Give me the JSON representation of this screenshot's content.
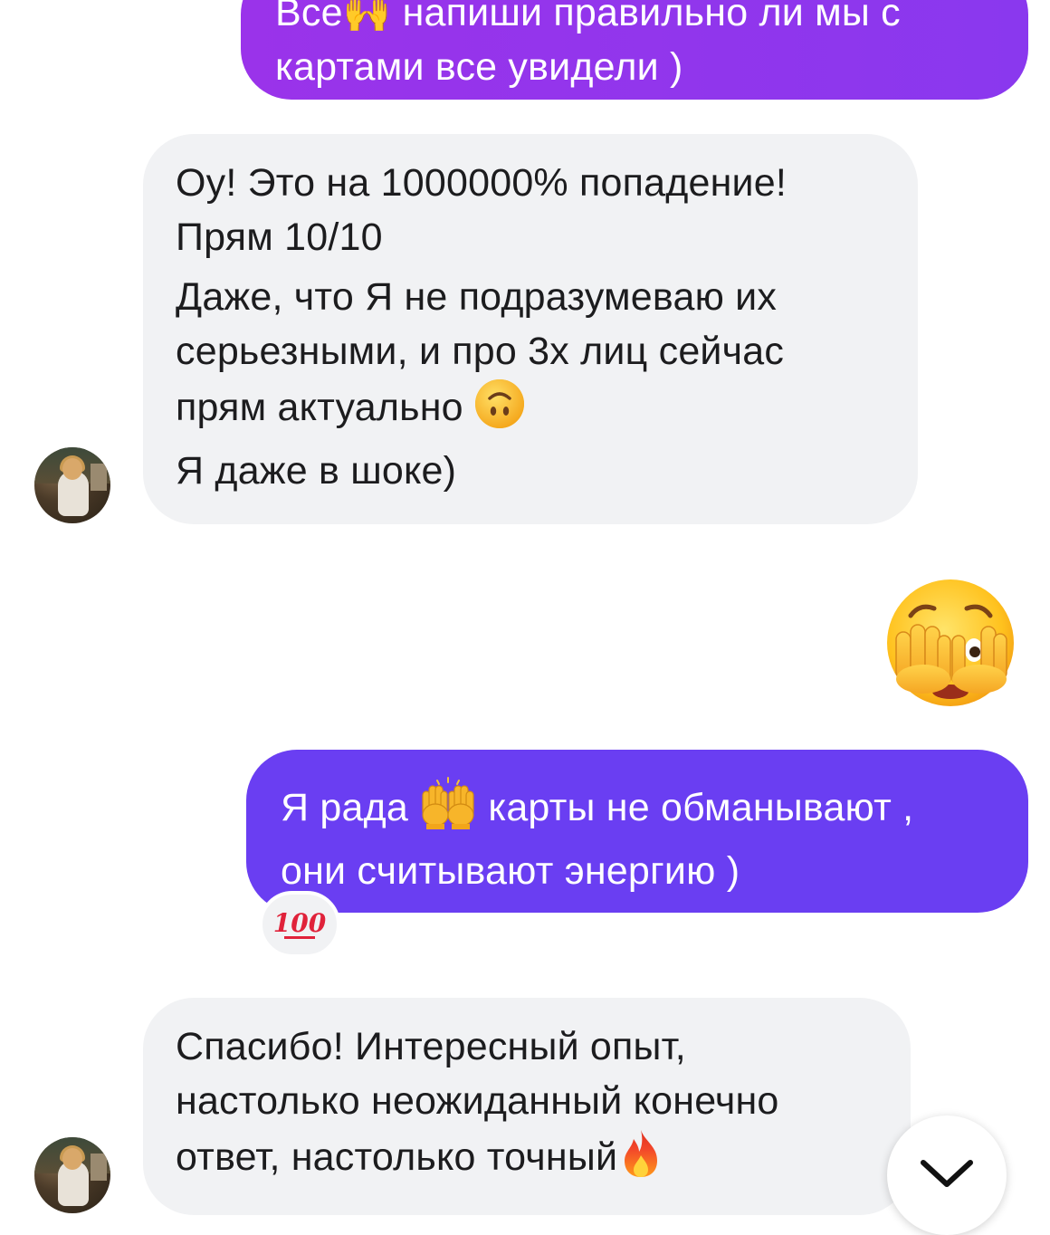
{
  "messages": [
    {
      "id": "out-1",
      "side": "outgoing",
      "lines": [
        "Все🙌 напиши правильно ли мы с",
        "картами все увидели )"
      ]
    },
    {
      "id": "in-1",
      "side": "incoming",
      "paragraphs": [
        [
          "Оу! Это на 1000000% попадение!",
          "Прям 10/10"
        ],
        [
          "Даже, что Я не подразумеваю их",
          "серьезными, и про 3х лиц сейчас",
          "прям актуально"
        ],
        [
          "Я даже в шоке)"
        ]
      ],
      "inline_emoji": "upside-down-face"
    },
    {
      "id": "out-2",
      "side": "outgoing",
      "emoji_only": "face-with-peeking-eye"
    },
    {
      "id": "out-3",
      "side": "outgoing",
      "lines_prefix": "Я рада",
      "lines_suffix": "карты не обманывают ,",
      "line_2": "они считывают энергию )",
      "inline_emoji": "raising-hands",
      "reaction": {
        "label": "100",
        "emoji": "hundred-points"
      }
    },
    {
      "id": "in-2",
      "side": "incoming",
      "lines": [
        "Спасибо! Интересный опыт,",
        "настолько неожиданный конечно",
        "ответ, настолько точный"
      ],
      "inline_emoji": "fire"
    }
  ],
  "colors": {
    "outgoing_gradient": "#9a33ea",
    "outgoing_solid": "#6a3ef2",
    "incoming_bg": "#f1f2f4",
    "text_dark": "#1c1c1e"
  },
  "scroll_button": {
    "icon": "chevron-down-icon"
  }
}
